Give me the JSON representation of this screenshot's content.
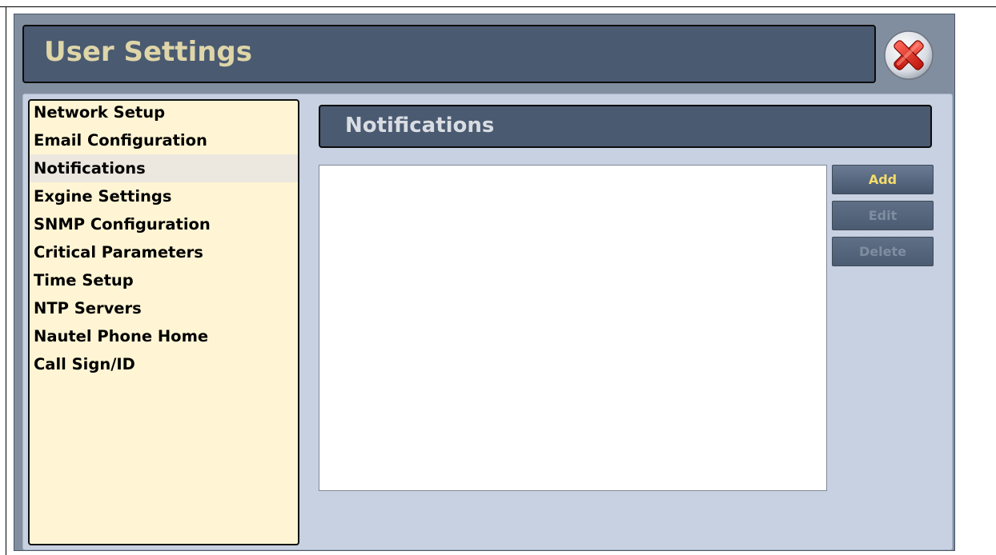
{
  "window": {
    "title": "User Settings",
    "close_icon": "close-x-icon"
  },
  "sidebar": {
    "items": [
      {
        "label": "Network Setup"
      },
      {
        "label": "Email Configuration"
      },
      {
        "label": "Notifications",
        "selected": true
      },
      {
        "label": "Exgine Settings"
      },
      {
        "label": "SNMP Configuration"
      },
      {
        "label": "Critical Parameters"
      },
      {
        "label": "Time Setup"
      },
      {
        "label": "NTP Servers"
      },
      {
        "label": "Nautel Phone Home"
      },
      {
        "label": "Call Sign/ID"
      }
    ]
  },
  "main": {
    "section_title": "Notifications",
    "notifications_list": [],
    "buttons": {
      "add_label": "Add",
      "edit_label": "Edit",
      "delete_label": "Delete"
    }
  },
  "colors": {
    "title_bar": "#4a5a71",
    "title_text": "#ded5a8",
    "panel_bg": "#c7d1e1",
    "sidebar_bg": "#fff5d4",
    "add_text": "#f4dc6a"
  }
}
